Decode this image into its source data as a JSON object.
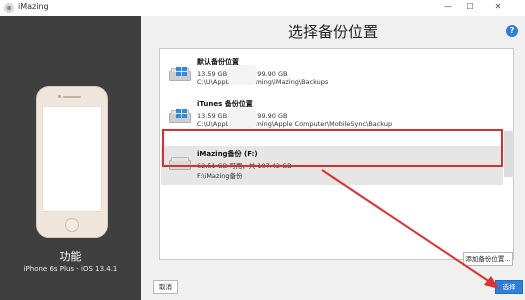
{
  "window": {
    "title": "iMazing",
    "minimize_glyph": "—",
    "maximize_glyph": "☐",
    "close_glyph": "✕"
  },
  "device": {
    "function_label": "功能",
    "name": "iPhone 6s Plus - iOS 13.4.1"
  },
  "main": {
    "heading": "选择备份位置",
    "help_glyph": "?"
  },
  "locations": [
    {
      "title": "默认备份位置",
      "space": "13.59 GB 可用，共 99.90 GB",
      "path": "C:\\U\\AppData\\Roaming\\iMazing\\Backups",
      "icon": "windows-drive-icon"
    },
    {
      "title": "iTunes 备份位置",
      "space": "13.59 GB 可用，共 99.90 GB",
      "path": "C:\\U\\AppData\\Roaming\\Apple Computer\\MobileSync\\Backup",
      "icon": "windows-drive-icon"
    },
    {
      "title": "iMazing备份 (F:)",
      "space": "62.51 GB 可用，共 107.42 GB",
      "path": "F:\\iMazing备份",
      "icon": "drive-icon"
    }
  ],
  "buttons": {
    "add_location": "添加备份位置...",
    "cancel": "取消",
    "choose": "选择"
  },
  "colors": {
    "accent": "#2e7fd9",
    "highlight": "#d9302c",
    "sidebar": "#3f3f3f"
  }
}
